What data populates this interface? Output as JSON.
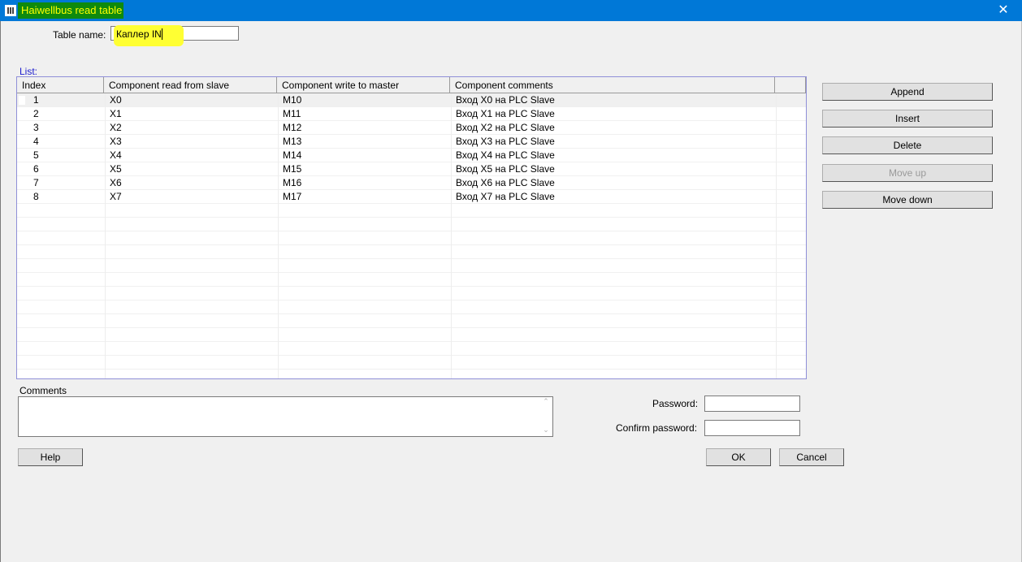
{
  "window": {
    "title": "Haiwellbus read table",
    "close_glyph": "✕"
  },
  "table_name": {
    "label": "Table name:",
    "value": "Каплер IN"
  },
  "list": {
    "label": "List:",
    "columns": [
      "Index",
      "Component read from slave",
      "Component write to master",
      "Component comments"
    ],
    "rows": [
      {
        "index": "1",
        "read": "X0",
        "write": "M10",
        "comment": "Вход X0 на PLC Slave"
      },
      {
        "index": "2",
        "read": "X1",
        "write": "M11",
        "comment": "Вход X1 на PLC Slave"
      },
      {
        "index": "3",
        "read": "X2",
        "write": "M12",
        "comment": "Вход X2 на PLC Slave"
      },
      {
        "index": "4",
        "read": "X3",
        "write": "M13",
        "comment": "Вход X3 на PLC Slave"
      },
      {
        "index": "5",
        "read": "X4",
        "write": "M14",
        "comment": "Вход X4 на PLC Slave"
      },
      {
        "index": "6",
        "read": "X5",
        "write": "M15",
        "comment": "Вход X5 на PLC Slave"
      },
      {
        "index": "7",
        "read": "X6",
        "write": "M16",
        "comment": "Вход X6 на PLC Slave"
      },
      {
        "index": "8",
        "read": "X7",
        "write": "M17",
        "comment": "Вход X7 на PLC Slave"
      }
    ]
  },
  "side_buttons": {
    "append": "Append",
    "insert": "Insert",
    "delete": "Delete",
    "move_up": "Move up",
    "move_down": "Move down"
  },
  "comments": {
    "label": "Comments",
    "value": ""
  },
  "password": {
    "label": "Password:",
    "confirm_label": "Confirm password:"
  },
  "footer": {
    "help": "Help",
    "ok": "OK",
    "cancel": "Cancel"
  },
  "colors": {
    "titlebar": "#0078d7",
    "title_highlight": "#0e8a0e",
    "title_text": "#ffff00",
    "name_highlight": "#ffff33",
    "grid_border": "#8f8fd8"
  }
}
